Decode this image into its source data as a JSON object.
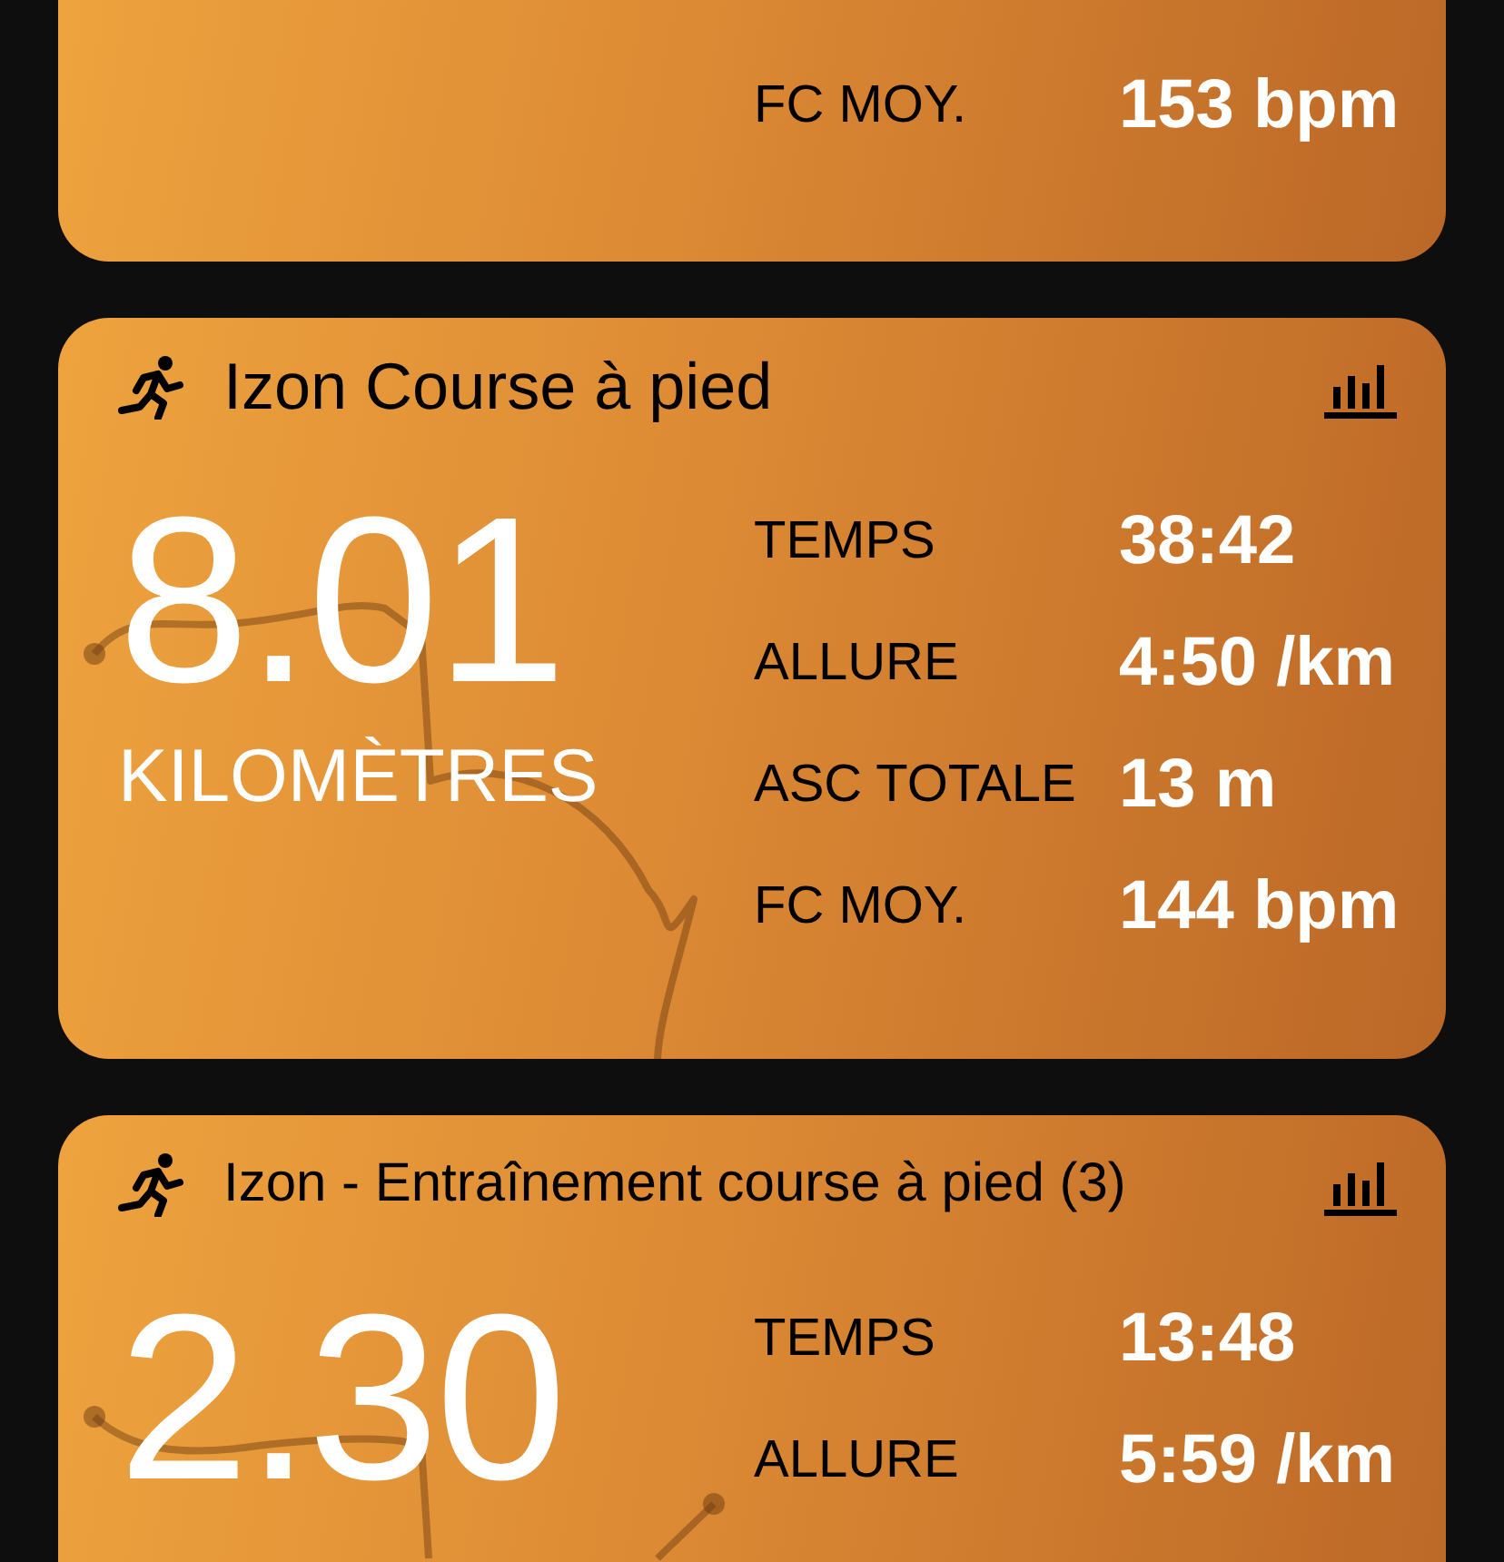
{
  "activities": [
    {
      "stats": [
        {
          "label": "FC MOY.",
          "value": "153 bpm"
        }
      ]
    },
    {
      "title": "Izon Course à pied",
      "distance": "8.01",
      "unit": "KILOMÈTRES",
      "stats": [
        {
          "label": "TEMPS",
          "value": "38:42"
        },
        {
          "label": "ALLURE",
          "value": "4:50 /km"
        },
        {
          "label": "ASC TOTALE",
          "value": "13 m"
        },
        {
          "label": "FC MOY.",
          "value": "144 bpm"
        }
      ]
    },
    {
      "title": "Izon - Entraînement course à pied (3)",
      "distance": "2.30",
      "stats": [
        {
          "label": "TEMPS",
          "value": "13:48"
        },
        {
          "label": "ALLURE",
          "value": "5:59 /km"
        }
      ]
    }
  ]
}
